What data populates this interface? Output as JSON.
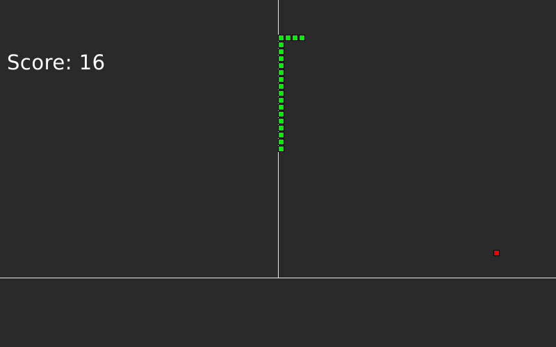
{
  "game": {
    "score_label": "Score:",
    "score_value": "16"
  },
  "colors": {
    "background": "#2a2a2a",
    "grid_line": "#e8e8e8",
    "snake": "#00ee00",
    "food": "#ee0000",
    "cell_border": "#000000"
  },
  "board": {
    "cell_size": 10,
    "snake_cells": [
      [
        43,
        5
      ],
      [
        42,
        5
      ],
      [
        41,
        5
      ],
      [
        40,
        5
      ],
      [
        40,
        6
      ],
      [
        40,
        7
      ],
      [
        40,
        8
      ],
      [
        40,
        9
      ],
      [
        40,
        10
      ],
      [
        40,
        11
      ],
      [
        40,
        12
      ],
      [
        40,
        13
      ],
      [
        40,
        14
      ],
      [
        40,
        15
      ],
      [
        40,
        16
      ],
      [
        40,
        17
      ],
      [
        40,
        18
      ],
      [
        40,
        19
      ],
      [
        40,
        20
      ],
      [
        40,
        21
      ]
    ],
    "food_cell": [
      71,
      36
    ]
  }
}
